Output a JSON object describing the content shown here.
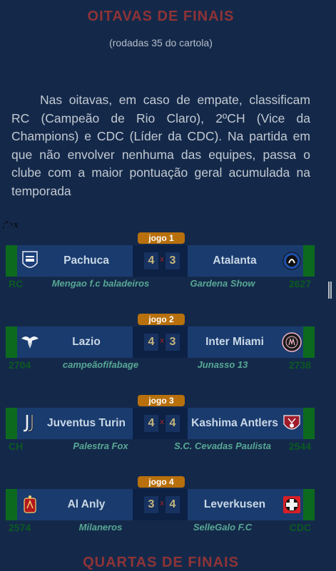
{
  "header": {
    "title": "OITAVAS DE FINAIS",
    "subtitle": "(rodadas 35 do cartola)"
  },
  "description": "Nas oitavas, em caso de empate, classificam RC (Campeão de Rio Claro), 2ºCH (Vice da Champions) e CDC (Líder da CDC). Na partida em que não envolver nenhuma das equipes, passa o clube com a maior pontuação geral acumulada na temporada",
  "stray_text": ";\">x",
  "vs_symbol": "x",
  "matches": [
    {
      "label": "jogo 1",
      "home": {
        "team": "Pachuca",
        "score": "4",
        "code": "RC",
        "coach": "Mengao f.c baladeiros",
        "logo": "pachuca-crest-icon"
      },
      "away": {
        "team": "Atalanta",
        "score": "3",
        "code": "2627",
        "coach": "Gardena Show",
        "logo": "atalanta-crest-icon"
      }
    },
    {
      "label": "jogo 2",
      "home": {
        "team": "Lazio",
        "score": "4",
        "code": "2704",
        "coach": "campeãofifabage",
        "logo": "lazio-crest-icon"
      },
      "away": {
        "team": "Inter Miami",
        "score": "3",
        "code": "2738",
        "coach": "Junasso 13",
        "logo": "inter-miami-crest-icon"
      }
    },
    {
      "label": "jogo 3",
      "home": {
        "team": "Juventus Turin",
        "score": "4",
        "code": "CH",
        "coach": "Palestra Fox",
        "logo": "juventus-crest-icon"
      },
      "away": {
        "team": "Kashima Antlers",
        "score": "4",
        "code": "2544",
        "coach": "S.C. Cevadas Paulista",
        "logo": "kashima-crest-icon"
      }
    },
    {
      "label": "jogo 4",
      "home": {
        "team": "Al Anly",
        "score": "3",
        "code": "2574",
        "coach": "Milaneros",
        "logo": "al-ahly-crest-icon"
      },
      "away": {
        "team": "Leverkusen",
        "score": "4",
        "code": "CDC",
        "coach": "SelleGalo F.C",
        "logo": "leverkusen-crest-icon"
      }
    }
  ],
  "next_section_title": "QUARTAS DE FINAIS",
  "colors": {
    "background": "#14294a",
    "title": "#8f3336",
    "badge": "#b8700c",
    "team_bg": "#1a3b6e",
    "stripe": "#0c6a1e",
    "coach": "#58a894",
    "score": "#c6b57c"
  }
}
